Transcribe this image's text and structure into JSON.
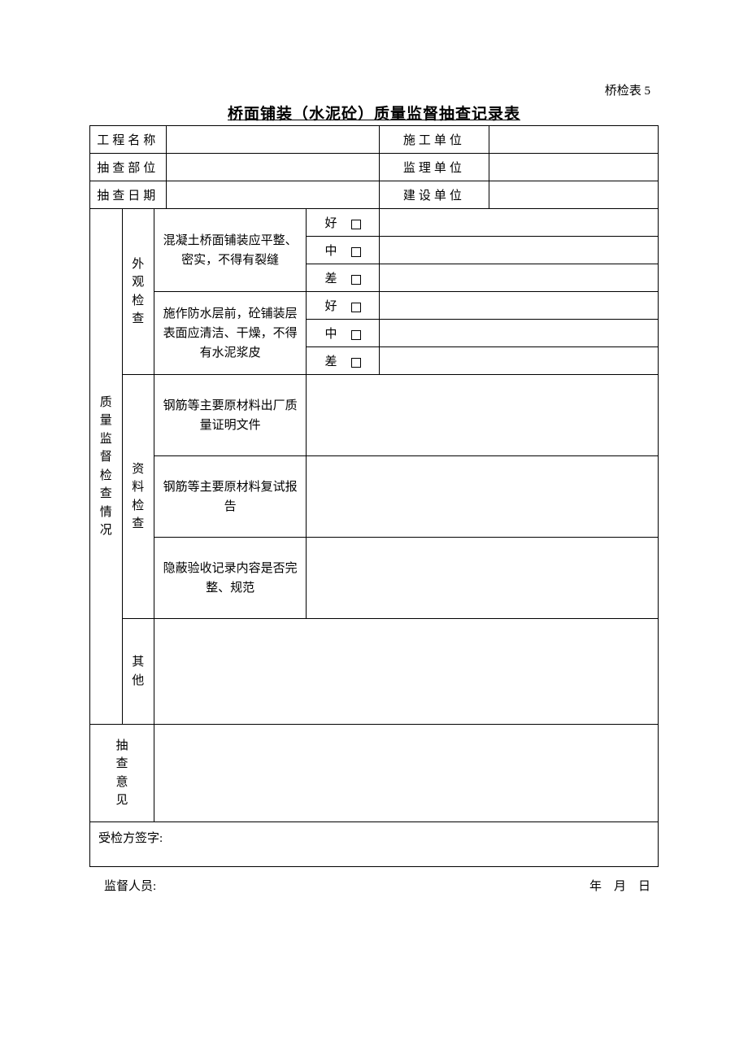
{
  "form_code": "桥检表 5",
  "title": "桥面铺装（水泥砼）质量监督抽查记录表",
  "headers": {
    "project_name": "工程名称",
    "construction_unit": "施工单位",
    "check_part": "抽查部位",
    "supervision_unit": "监理单位",
    "check_date": "抽查日期",
    "build_unit": "建设单位"
  },
  "main_category": "质量监督检查情况",
  "visual_category": "外观检查",
  "visual_item1": "混凝土桥面铺装应平整、密实，不得有裂缝",
  "visual_item2": "施作防水层前，砼铺装层表面应清洁、干燥，不得有水泥浆皮",
  "ratings": {
    "good": "好",
    "medium": "中",
    "bad": "差"
  },
  "doc_category": "资料检查",
  "doc_item1": "钢筋等主要原材料出厂质量证明文件",
  "doc_item2": "钢筋等主要原材料复试报告",
  "doc_item3": "隐蔽验收记录内容是否完整、规范",
  "other_category": "其他",
  "opinion_label": "抽查意见",
  "signature_label": "受检方签字:",
  "footer": {
    "inspector": "监督人员:",
    "date": "年 月 日"
  }
}
